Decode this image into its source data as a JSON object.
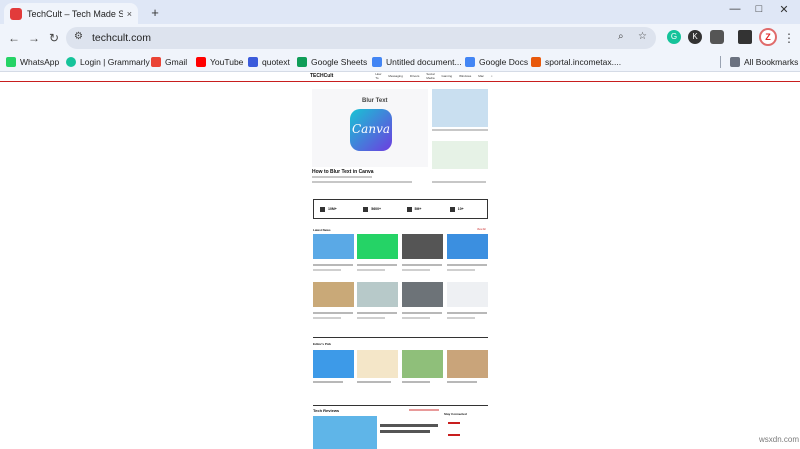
{
  "browser": {
    "tab_title": "TechCult – Tech Made Simple",
    "tab_close": "×",
    "new_tab": "+",
    "window": {
      "minimize": "—",
      "maximize": "□",
      "close": "✕"
    },
    "nav": {
      "back": "←",
      "forward": "→",
      "reload": "↻"
    },
    "url": "techcult.com",
    "profile_initial": "Z",
    "bookmarks": [
      {
        "label": "WhatsApp",
        "color": "#25d366"
      },
      {
        "label": "Login | Grammarly",
        "color": "#15c39a"
      },
      {
        "label": "Gmail",
        "color": "#ea4335"
      },
      {
        "label": "YouTube",
        "color": "#ff0000"
      },
      {
        "label": "quotext",
        "color": "#3b5bdb"
      },
      {
        "label": "Google Sheets",
        "color": "#0f9d58"
      },
      {
        "label": "Untitled document...",
        "color": "#4285f4"
      },
      {
        "label": "Google Docs",
        "color": "#4285f4"
      },
      {
        "label": "sportal.incometax....",
        "color": "#e8590c"
      }
    ],
    "all_bookmarks": "All Bookmarks"
  },
  "site": {
    "logo": "TECHCult",
    "nav_links": [
      "How To",
      "Messaging",
      "Drivers",
      "Social Media",
      "Gaming",
      "Windows",
      "Mac"
    ],
    "hero_title": "How to Blur Text in Canva",
    "hero_image_text": "Blur Text",
    "hero_logo_word": "Canva",
    "stats": [
      "10M+",
      "5600+",
      "5M+",
      "10+"
    ],
    "latest_heading": "Latest News",
    "view_all": "View All",
    "editors_heading": "Editor's Pick",
    "reviews_heading": "Tech Reviews",
    "stay_connected": "Stay Connected"
  },
  "watermark": "wsxdn.com"
}
